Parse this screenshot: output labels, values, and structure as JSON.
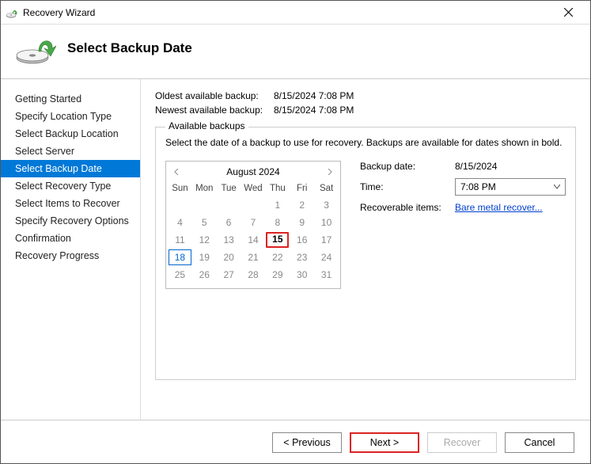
{
  "window": {
    "title": "Recovery Wizard"
  },
  "header": {
    "title": "Select Backup Date"
  },
  "sidebar": {
    "items": [
      {
        "label": "Getting Started",
        "selected": false
      },
      {
        "label": "Specify Location Type",
        "selected": false
      },
      {
        "label": "Select Backup Location",
        "selected": false
      },
      {
        "label": "Select Server",
        "selected": false
      },
      {
        "label": "Select Backup Date",
        "selected": true
      },
      {
        "label": "Select Recovery Type",
        "selected": false
      },
      {
        "label": "Select Items to Recover",
        "selected": false
      },
      {
        "label": "Specify Recovery Options",
        "selected": false
      },
      {
        "label": "Confirmation",
        "selected": false
      },
      {
        "label": "Recovery Progress",
        "selected": false
      }
    ]
  },
  "info": {
    "oldest_label": "Oldest available backup:",
    "oldest_value": "8/15/2024 7:08 PM",
    "newest_label": "Newest available backup:",
    "newest_value": "8/15/2024 7:08 PM"
  },
  "fieldset": {
    "legend": "Available backups",
    "desc": "Select the date of a backup to use for recovery. Backups are available for dates shown in bold."
  },
  "calendar": {
    "month_title": "August 2024",
    "dow": [
      "Sun",
      "Mon",
      "Tue",
      "Wed",
      "Thu",
      "Fri",
      "Sat"
    ],
    "rows": [
      [
        "",
        "",
        "",
        "",
        "1",
        "2",
        "3"
      ],
      [
        "4",
        "5",
        "6",
        "7",
        "8",
        "9",
        "10"
      ],
      [
        "11",
        "12",
        "13",
        "14",
        "15",
        "16",
        "17"
      ],
      [
        "18",
        "19",
        "20",
        "21",
        "22",
        "23",
        "24"
      ],
      [
        "25",
        "26",
        "27",
        "28",
        "29",
        "30",
        "31"
      ]
    ],
    "selected_day": "15",
    "today_day": "18"
  },
  "details": {
    "backup_date_label": "Backup date:",
    "backup_date_value": "8/15/2024",
    "time_label": "Time:",
    "time_value": "7:08 PM",
    "recoverable_label": "Recoverable items:",
    "recoverable_link": "Bare metal recover..."
  },
  "footer": {
    "previous": "< Previous",
    "next": "Next >",
    "recover": "Recover",
    "cancel": "Cancel"
  }
}
